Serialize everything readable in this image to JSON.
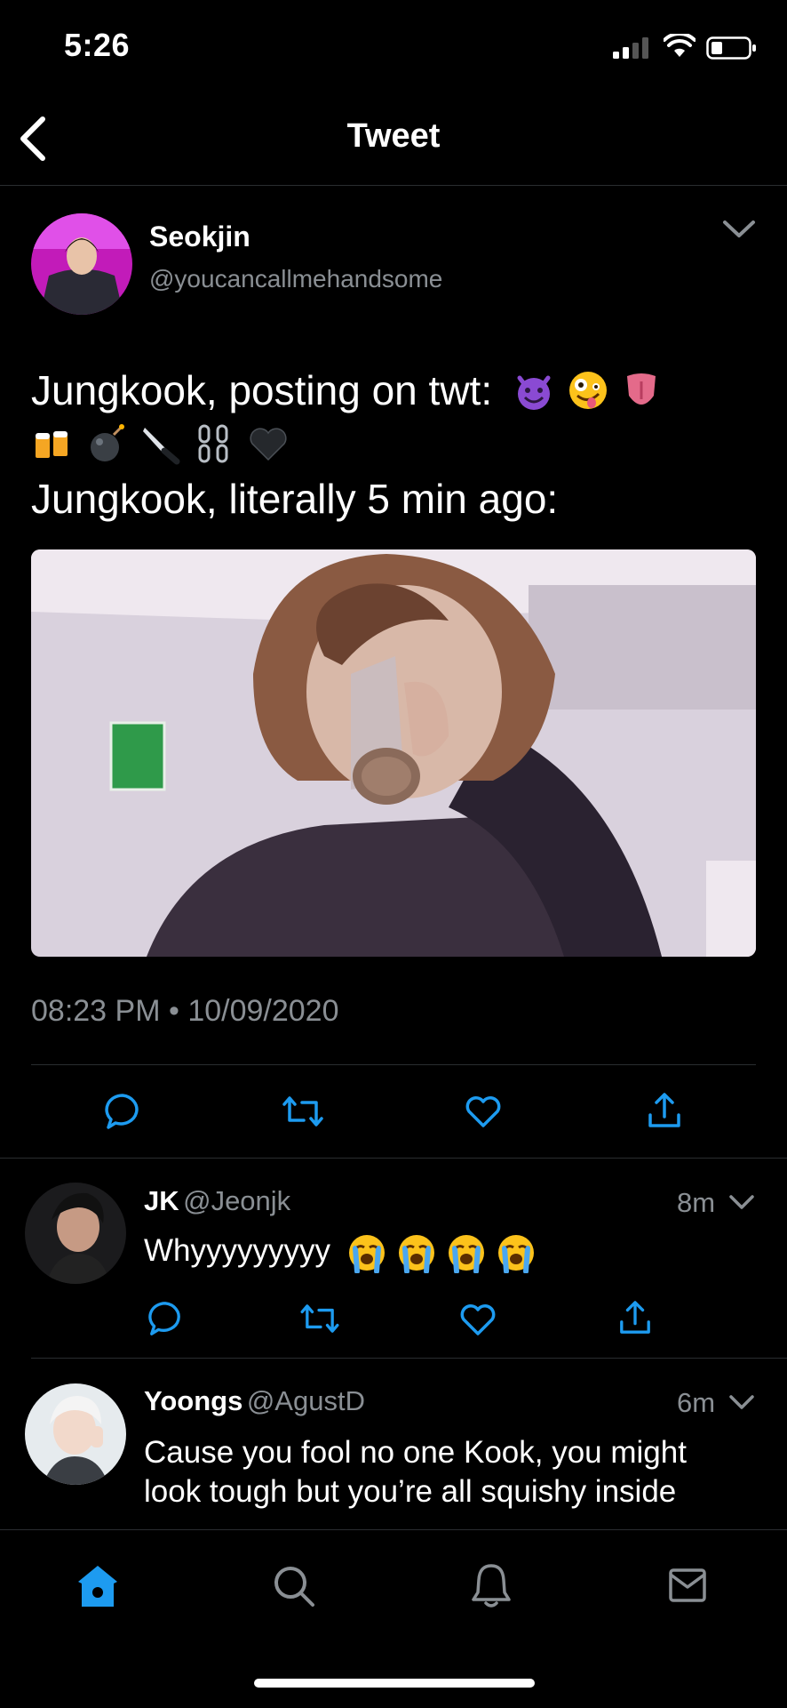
{
  "status_bar": {
    "time": "5:26"
  },
  "nav": {
    "title": "Tweet"
  },
  "tweet": {
    "author_name": "Seokjin",
    "author_handle": "@youcancallmehandsome",
    "line1": "Jungkook, posting on twt:",
    "line2_emoji": [
      "smiling-devil-emoji",
      "zany-face-emoji",
      "tongue-emoji",
      "beer-mugs-emoji",
      "bomb-emoji",
      "knife-emoji",
      "chains-emoji",
      "black-heart-emoji"
    ],
    "line3": "Jungkook, literally 5 min ago:",
    "timestamp": "08:23 PM • 10/09/2020"
  },
  "replies": [
    {
      "name": "JK",
      "handle": "@Jeonjk",
      "time": "8m",
      "text": "Whyyyyyyyyy",
      "emoji": [
        "loudly-crying-emoji",
        "loudly-crying-emoji",
        "loudly-crying-emoji",
        "loudly-crying-emoji"
      ]
    },
    {
      "name": "Yoongs",
      "handle": "@AgustD",
      "time": "6m",
      "text_line1": "Cause you fool no one Kook, you might",
      "text_line2": "look tough but you’re all squishy inside"
    }
  ],
  "tabbar": {
    "items": [
      "home-icon",
      "search-icon",
      "notifications-icon",
      "messages-icon"
    ],
    "active": "home-icon"
  },
  "colors": {
    "accent": "#1d9bf0",
    "muted": "#8a8f94",
    "divider": "#2a2d30"
  }
}
